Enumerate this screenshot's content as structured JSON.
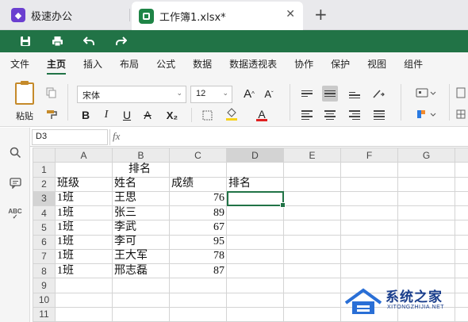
{
  "tabs": [
    {
      "label": "极速办公",
      "icon": "app-logo-icon"
    },
    {
      "label": "工作簿1.xlsx*",
      "icon": "spreadsheet-icon",
      "close": "✕"
    }
  ],
  "new_tab": "+",
  "quick_access": [
    {
      "icon": "save-icon",
      "glyph": "🖫"
    },
    {
      "icon": "print-icon",
      "glyph": "⎙"
    },
    {
      "icon": "undo-icon",
      "glyph": "↶"
    },
    {
      "icon": "redo-icon",
      "glyph": "↷"
    }
  ],
  "menus": [
    "文件",
    "主页",
    "插入",
    "布局",
    "公式",
    "数据",
    "数据透视表",
    "协作",
    "保护",
    "视图",
    "组件"
  ],
  "active_menu": "主页",
  "ribbon": {
    "paste_label": "粘贴",
    "font_name": "宋体",
    "font_size": "12",
    "grow": "A",
    "shrink": "A",
    "bold": "B",
    "italic": "I",
    "underline": "U",
    "strike": "A",
    "subscript": "X₂",
    "font_color_glyph": "A"
  },
  "formula_bar": {
    "cell_ref": "D3",
    "fx": "fx",
    "content": ""
  },
  "left_toolbar": [
    {
      "icon": "search-icon",
      "glyph": "⌕"
    },
    {
      "icon": "comment-icon",
      "glyph": "▭"
    },
    {
      "icon": "spellcheck-icon",
      "glyph": "ABC"
    }
  ],
  "sheet": {
    "columns": [
      "A",
      "B",
      "C",
      "D",
      "E",
      "F",
      "G"
    ],
    "selected_col": "D",
    "selected_row": 3,
    "rows": [
      {
        "n": "1",
        "A": "",
        "B": "排名",
        "C": "",
        "D": ""
      },
      {
        "n": "2",
        "A": "班级",
        "B": "姓名",
        "C": "成绩",
        "D": "排名"
      },
      {
        "n": "3",
        "A": "1班",
        "B": "王思",
        "C": "76",
        "D": ""
      },
      {
        "n": "4",
        "A": "1班",
        "B": "张三",
        "C": "89",
        "D": ""
      },
      {
        "n": "5",
        "A": "1班",
        "B": "李武",
        "C": "67",
        "D": ""
      },
      {
        "n": "6",
        "A": "1班",
        "B": "李可",
        "C": "95",
        "D": ""
      },
      {
        "n": "7",
        "A": "1班",
        "B": "王大军",
        "C": "78",
        "D": ""
      },
      {
        "n": "8",
        "A": "1班",
        "B": "邢志磊",
        "C": "87",
        "D": ""
      },
      {
        "n": "9",
        "A": "",
        "B": "",
        "C": "",
        "D": ""
      },
      {
        "n": "10",
        "A": "",
        "B": "",
        "C": "",
        "D": ""
      },
      {
        "n": "11",
        "A": "",
        "B": "",
        "C": "",
        "D": ""
      }
    ]
  },
  "watermark": {
    "title": "系统之家",
    "subtitle": "XITONGZHIJIA.NET"
  },
  "colors": {
    "accent": "#217346",
    "tab_logo": "#6b3fd0",
    "watermark": "#1a3e8c"
  }
}
